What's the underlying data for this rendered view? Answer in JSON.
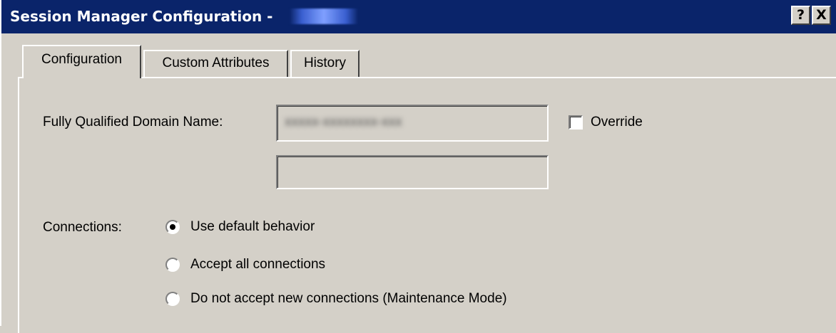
{
  "window": {
    "title": "Session Manager Configuration -",
    "help_button": "?",
    "close_button": "X"
  },
  "tabs": [
    {
      "label": "Configuration",
      "selected": true
    },
    {
      "label": "Custom Attributes",
      "selected": false
    },
    {
      "label": "History",
      "selected": false
    }
  ],
  "form": {
    "fqdn_label": "Fully Qualified Domain Name:",
    "override_label": "Override",
    "override_checked": false,
    "connections_label": "Connections:",
    "connection_options": [
      {
        "label": "Use default behavior",
        "selected": true
      },
      {
        "label": "Accept all connections",
        "selected": false
      },
      {
        "label": "Do not accept new connections (Maintenance Mode)",
        "selected": false
      }
    ]
  }
}
